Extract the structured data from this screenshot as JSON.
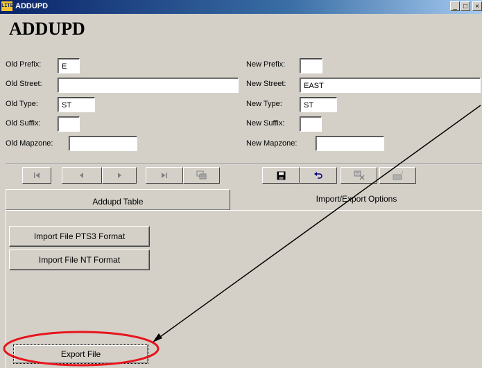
{
  "window": {
    "title": "ADDUPD",
    "icon_text": "LITE",
    "controls": {
      "minimize": "_",
      "maximize": "□",
      "close": "×"
    }
  },
  "form": {
    "heading": "ADDUPD",
    "old": {
      "prefix_label": "Old Prefix:",
      "prefix_value": "E",
      "street_label": "Old Street:",
      "street_value": "",
      "type_label": "Old Type:",
      "type_value": "ST",
      "suffix_label": "Old Suffix:",
      "suffix_value": "",
      "mapzone_label": "Old Mapzone:",
      "mapzone_value": ""
    },
    "new": {
      "prefix_label": "New Prefix:",
      "prefix_value": "",
      "street_label": "New Street:",
      "street_value": "EAST",
      "type_label": "New Type:",
      "type_value": "ST",
      "suffix_label": "New Suffix:",
      "suffix_value": "",
      "mapzone_label": "New Mapzone:",
      "mapzone_value": ""
    }
  },
  "toolbar": {
    "nav_buttons": [
      "first-record-icon",
      "previous-record-icon",
      "next-record-icon",
      "last-record-icon",
      "find-record-icon"
    ],
    "edit_buttons": [
      "save-icon",
      "undo-icon",
      "delete-record-icon",
      "new-record-icon"
    ]
  },
  "tabs": [
    {
      "label": "Addupd Table",
      "active": false
    },
    {
      "label": "Import/Export Options",
      "active": true
    }
  ],
  "import_export": {
    "import_pts3_label": "Import File PTS3 Format",
    "import_nt_label": "Import File NT Format",
    "export_label": "Export File"
  },
  "annotation": {
    "highlight_color": "#e8141c",
    "arrow_color": "#000000",
    "target": "export-file-button"
  }
}
